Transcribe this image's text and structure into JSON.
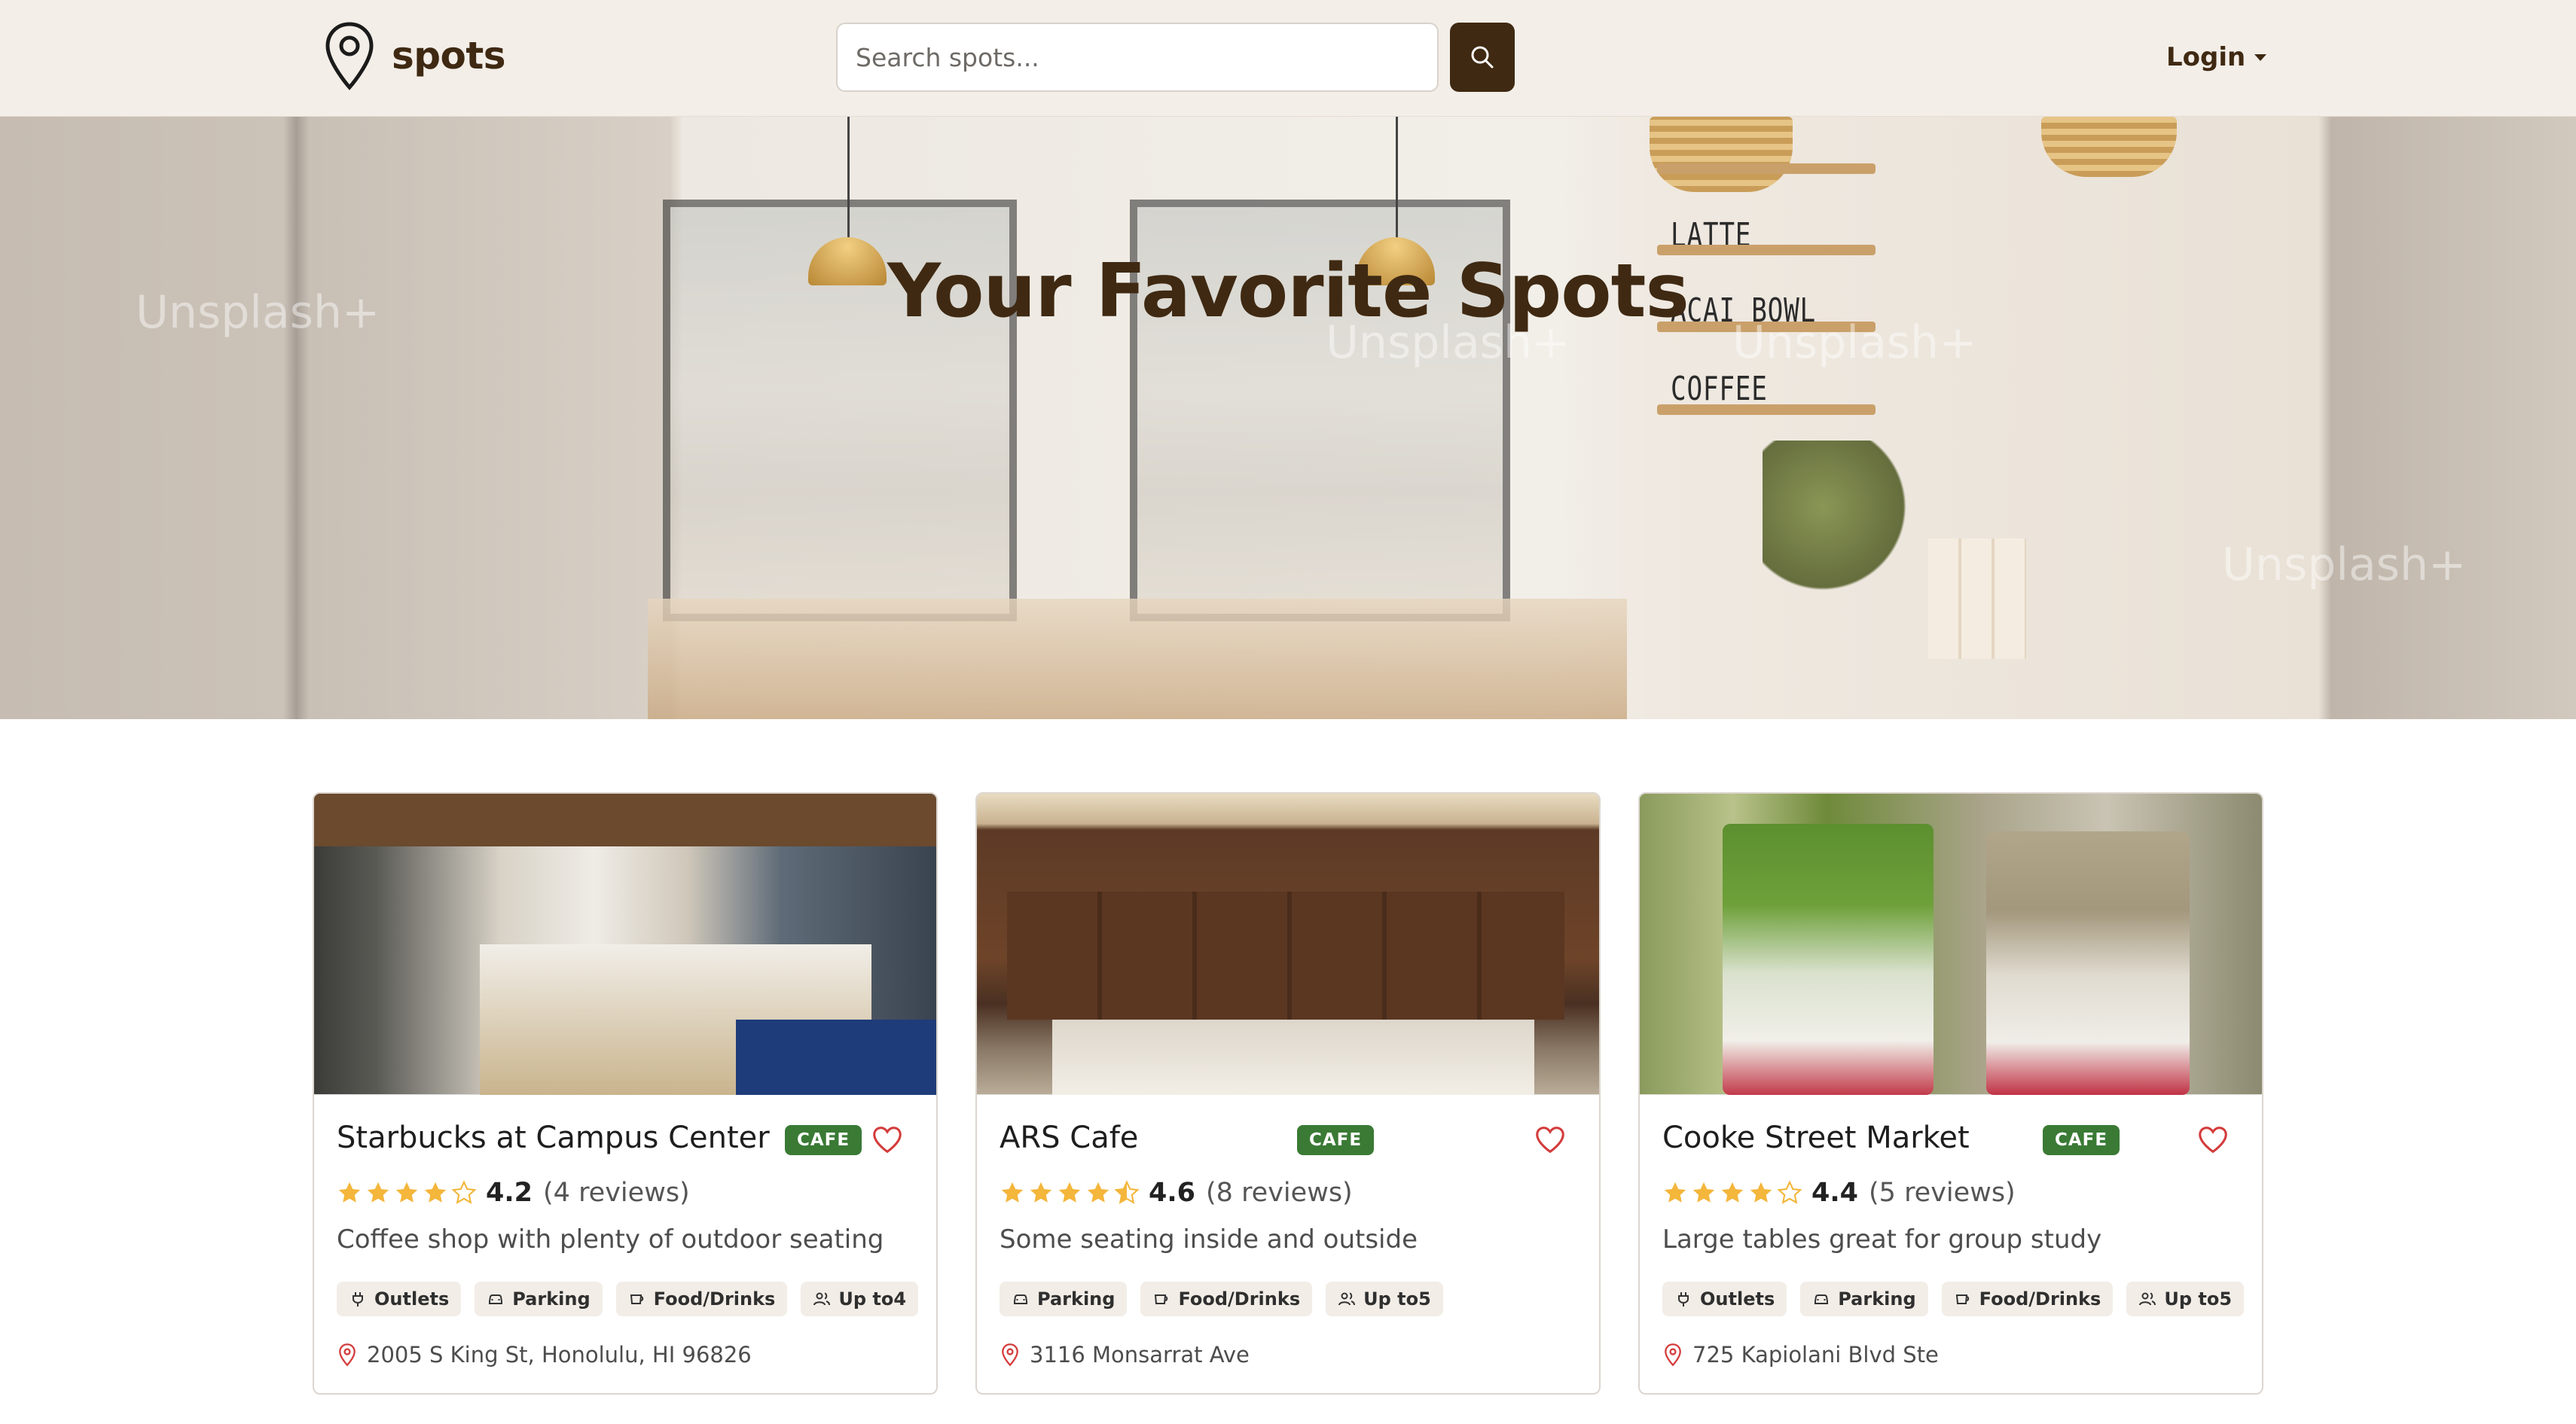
{
  "navbar": {
    "brand": "spots",
    "search_placeholder": "Search spots...",
    "login_label": "Login"
  },
  "hero": {
    "title": "Your Favorite Spots",
    "menu_board": [
      "LATTE",
      "ACAI BOWL",
      "COFFEE"
    ],
    "watermark": "Unsplash+"
  },
  "colors": {
    "brand": "#3f2912",
    "navbar_bg": "#f3eee8",
    "badge_bg": "#3a7a35",
    "star": "#f4b63b",
    "heart": "#d43b3b",
    "tag_bg": "#f2ede7"
  },
  "cards": [
    {
      "name": "Starbucks at Campus Center",
      "category": "CAFE",
      "rating": "4.2",
      "reviews": "(4 reviews)",
      "stars": 4,
      "description": "Coffee shop with plenty of outdoor seating",
      "tags": [
        {
          "icon": "plug-icon",
          "label": "Outlets"
        },
        {
          "icon": "car-icon",
          "label": "Parking"
        },
        {
          "icon": "cup-icon",
          "label": "Food/Drinks"
        },
        {
          "icon": "users-icon",
          "label": "Up to4"
        }
      ],
      "address": "2005 S King St, Honolulu, HI 96826"
    },
    {
      "name": "ARS Cafe",
      "category": "CAFE",
      "rating": "4.6",
      "reviews": "(8 reviews)",
      "stars": 4.5,
      "description": "Some seating inside and outside",
      "tags": [
        {
          "icon": "car-icon",
          "label": "Parking"
        },
        {
          "icon": "cup-icon",
          "label": "Food/Drinks"
        },
        {
          "icon": "users-icon",
          "label": "Up to5"
        }
      ],
      "address": "3116 Monsarrat Ave"
    },
    {
      "name": "Cooke Street Market",
      "category": "CAFE",
      "rating": "4.4",
      "reviews": "(5 reviews)",
      "stars": 4,
      "description": "Large tables great for group study",
      "tags": [
        {
          "icon": "plug-icon",
          "label": "Outlets"
        },
        {
          "icon": "car-icon",
          "label": "Parking"
        },
        {
          "icon": "cup-icon",
          "label": "Food/Drinks"
        },
        {
          "icon": "users-icon",
          "label": "Up to5"
        }
      ],
      "address": "725 Kapiolani Blvd Ste"
    }
  ]
}
